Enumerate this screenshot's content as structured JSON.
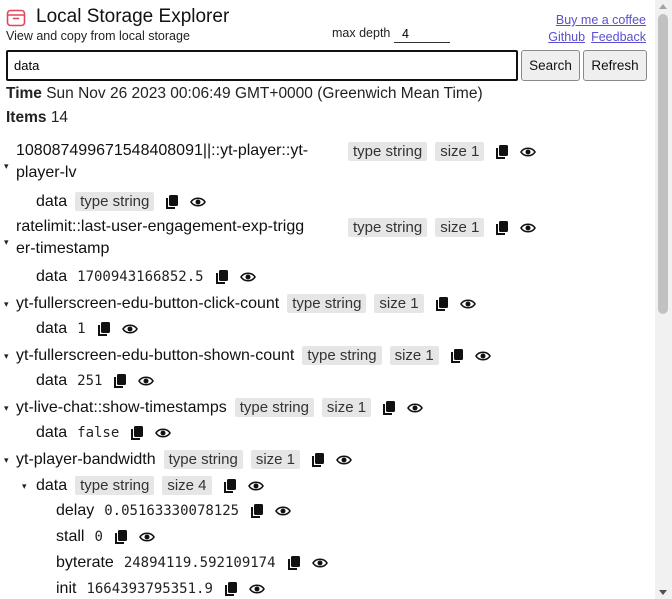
{
  "app": {
    "title": "Local Storage Explorer",
    "subtitle": "View and copy from local storage",
    "depth_label": "max depth",
    "depth_value": "4",
    "links": [
      "Buy me a coffee",
      "Github",
      "Feedback"
    ]
  },
  "search": {
    "value": "data",
    "search_label": "Search",
    "refresh_label": "Refresh"
  },
  "meta": {
    "time_label": "Time",
    "time_value": "Sun Nov 26 2023 00:06:49 GMT+0000 (Greenwich Mean Time)",
    "items_label": "Items",
    "items_value": "14"
  },
  "entries": [
    {
      "key_line1": "1080874996715484080​91||::yt-player::yt-",
      "key_line2": "player-lv",
      "type": "type string",
      "size": "size 1",
      "data_label": "data",
      "data_value": "type string"
    },
    {
      "key_line1": "ratelimit::last-user-engagement-exp-trigg",
      "key_line2": "er-timestamp",
      "type": "type string",
      "size": "size 1",
      "data_label": "data",
      "data_value": "1700943166852.5"
    },
    {
      "key": "yt-fullerscreen-edu-button-click-count",
      "type": "type string",
      "size": "size 1",
      "data_label": "data",
      "data_value": "1"
    },
    {
      "key": "yt-fullerscreen-edu-button-shown-count",
      "type": "type string",
      "size": "size 1",
      "data_label": "data",
      "data_value": "251"
    },
    {
      "key": "yt-live-chat::show-timestamps",
      "type": "type string",
      "size": "size 1",
      "data_label": "data",
      "data_value": "false"
    },
    {
      "key": "yt-player-bandwidth",
      "type": "type string",
      "size": "size 1",
      "data_label": "data",
      "data_type": "type string",
      "data_size": "size 4",
      "children": [
        {
          "key": "delay",
          "value": "0.05163330078125"
        },
        {
          "key": "stall",
          "value": "0"
        },
        {
          "key": "byterate",
          "value": "24894119.592109174"
        },
        {
          "key": "init",
          "value": "1664393795351.9"
        }
      ]
    }
  ],
  "colors": {
    "link": "#5a4fcf",
    "pill_bg": "#e6e6e6",
    "logo": "#e0475a"
  },
  "icons": {
    "copy": "copy-icon",
    "view": "eye-icon",
    "expand": "caret-down-icon",
    "logo": "archive-box-icon"
  }
}
